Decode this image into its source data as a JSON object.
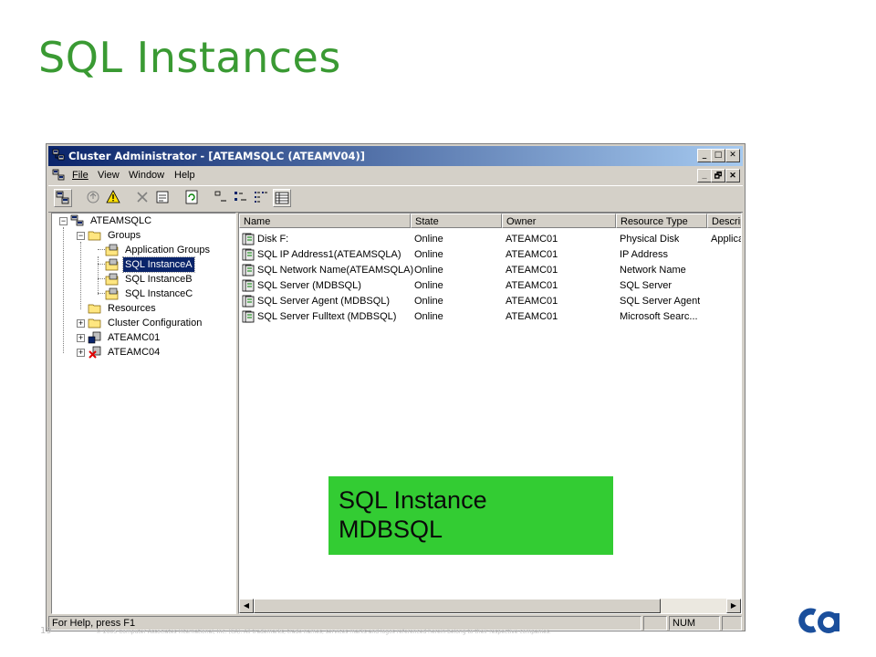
{
  "slide": {
    "title": "SQL Instances",
    "page_number": "19",
    "copyright": "© 2005 Computer Associates International, Inc. (CA). All trademarks, trade names, services marks and logos referenced herein belong to their respective companies."
  },
  "window": {
    "title": "Cluster Administrator - [ATEAMSQLC (ATEAMV04)]",
    "buttons": {
      "minimize": "_",
      "maximize": "□",
      "close": "✕",
      "restore": "🗗"
    }
  },
  "menu": {
    "items": [
      "File",
      "View",
      "Window",
      "Help"
    ],
    "mnemonics": [
      "F",
      "V",
      "W",
      "H"
    ]
  },
  "toolbar": {
    "icons": [
      "open-connection-icon",
      "bring-online-icon",
      "take-offline-icon",
      "delete-icon",
      "properties-icon",
      "refresh-icon",
      "large-icons-view-icon",
      "small-icons-view-icon",
      "list-view-icon",
      "details-view-icon"
    ]
  },
  "tree": {
    "root": "ATEAMSQLC",
    "groups": "Groups",
    "app_groups": "Application Groups",
    "inst_a": "SQL InstanceA",
    "inst_b": "SQL InstanceB",
    "inst_c": "SQL InstanceC",
    "resources": "Resources",
    "cluster_config": "Cluster Configuration",
    "node1": "ATEAMC01",
    "node2": "ATEAMC04",
    "selected": "SQL InstanceA"
  },
  "table": {
    "columns": [
      "Name",
      "State",
      "Owner",
      "Resource Type",
      "Descrip"
    ],
    "rows": [
      [
        "Disk F:",
        "Online",
        "ATEAMC01",
        "Physical Disk",
        "Applica"
      ],
      [
        "SQL IP Address1(ATEAMSQLA)",
        "Online",
        "ATEAMC01",
        "IP Address",
        ""
      ],
      [
        "SQL Network Name(ATEAMSQLA)",
        "Online",
        "ATEAMC01",
        "Network Name",
        ""
      ],
      [
        "SQL Server (MDBSQL)",
        "Online",
        "ATEAMC01",
        "SQL Server",
        ""
      ],
      [
        "SQL Server Agent (MDBSQL)",
        "Online",
        "ATEAMC01",
        "SQL Server Agent",
        ""
      ],
      [
        "SQL Server Fulltext (MDBSQL)",
        "Online",
        "ATEAMC01",
        "Microsoft Searc...",
        ""
      ]
    ]
  },
  "status_bar": {
    "help": "For Help, press F1",
    "num": "NUM"
  },
  "callout": {
    "line1": "SQL Instance",
    "line2": "MDBSQL"
  },
  "logo": {
    "text": "ca",
    "color": "#1b4f9c"
  },
  "colors": {
    "title_green": "#3a9a33",
    "callout_green": "#33cc33",
    "titlebar_start": "#0a246a",
    "titlebar_end": "#a6caf0"
  }
}
